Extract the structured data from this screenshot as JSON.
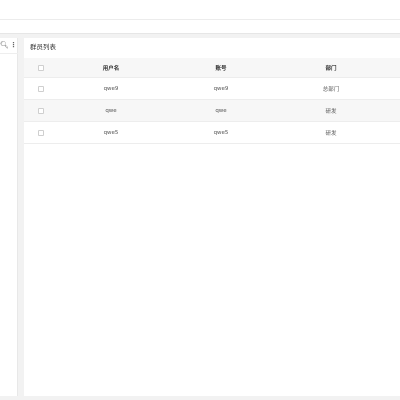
{
  "panel": {
    "title": "群员列表"
  },
  "toolbar": {
    "search_icon": "search-icon",
    "more_icon": "more-vertical-icon"
  },
  "table": {
    "headers": [
      "用户名",
      "账号",
      "部门"
    ],
    "rows": [
      [
        "qwe9",
        "qwe9",
        "总部门"
      ],
      [
        "qwe",
        "qwe",
        "研发"
      ],
      [
        "qwe5",
        "qwe5",
        "研发"
      ]
    ]
  }
}
